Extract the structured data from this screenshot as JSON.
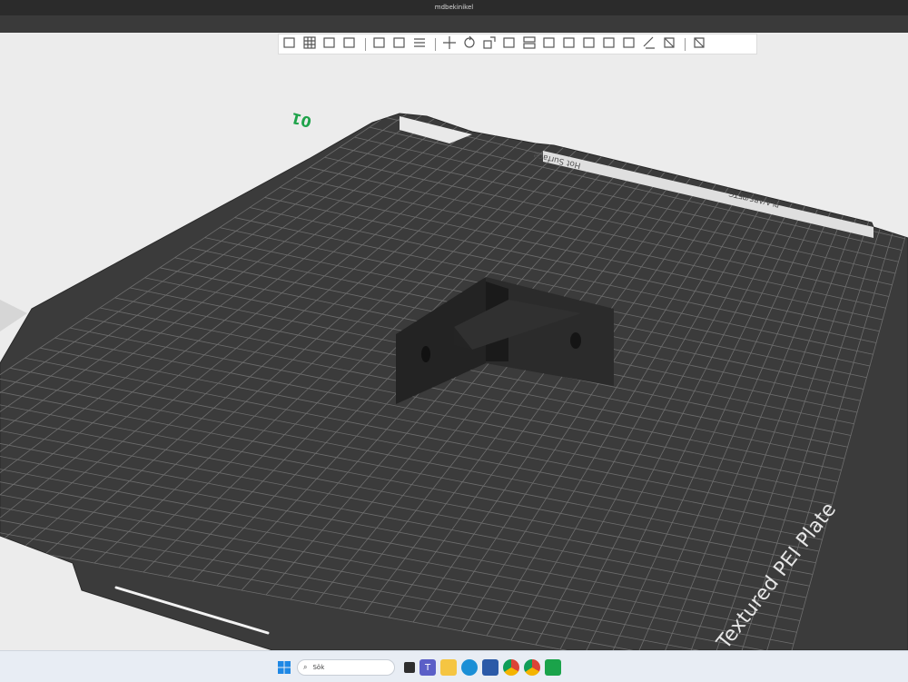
{
  "window": {
    "title": "mdbekinikel"
  },
  "bed": {
    "plate_label": "Textured PEI Plate",
    "material_label": "PLA/ABS/PETG",
    "corner_number": "01",
    "surface_label": "Hot Surface"
  },
  "toolbar": {
    "groups": [
      [
        "add-object",
        "add-plate",
        "auto-orient",
        "arrange"
      ],
      [
        "copy",
        "paste",
        "layers"
      ],
      [
        "move",
        "rotate",
        "scale",
        "lay-on-face",
        "cut",
        "mesh-boolean",
        "support-paint",
        "seam-paint",
        "fuzzy-skin",
        "text-emboss",
        "measure",
        "assembly"
      ],
      [
        "assembly-view"
      ]
    ]
  },
  "taskbar": {
    "search_placeholder": "Sök",
    "apps": [
      "windows-start",
      "search",
      "task-view",
      "teams",
      "file-explorer",
      "edge",
      "store",
      "chrome",
      "chrome-profile",
      "bambu-studio"
    ]
  }
}
